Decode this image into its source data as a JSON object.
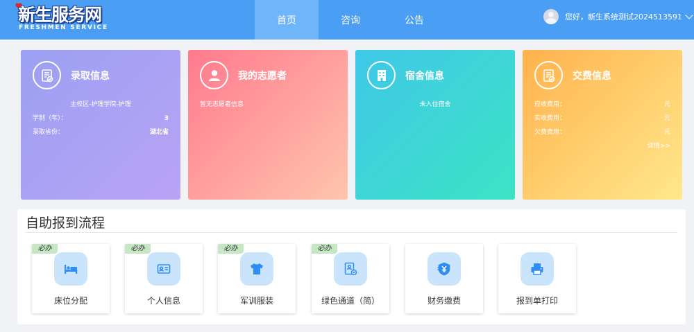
{
  "header": {
    "logo_main": "新生服务网",
    "logo_sub": "FRESHMEN SERVICE",
    "nav": [
      {
        "label": "首页",
        "active": true
      },
      {
        "label": "咨询",
        "active": false
      },
      {
        "label": "公告",
        "active": false
      }
    ],
    "user_greeting": "您好，新生系统测试2024513591"
  },
  "cards": {
    "admission": {
      "title": "录取信息",
      "icon": "document-check-icon",
      "campus_major": "主校区-护理学院-护理",
      "rows": [
        {
          "label": "学制（年）：",
          "value": "3"
        },
        {
          "label": "录取省份：",
          "value": "湖北省"
        }
      ]
    },
    "volunteer": {
      "title": "我的志愿者",
      "icon": "person-icon",
      "empty_text": "暂无志愿者信息"
    },
    "dorm": {
      "title": "宿舍信息",
      "icon": "building-icon",
      "empty_text": "未入住宿舍"
    },
    "fee": {
      "title": "交费信息",
      "icon": "document-check-icon",
      "rows": [
        {
          "label": "应收费用：",
          "value": "元"
        },
        {
          "label": "实收费用：",
          "value": "元"
        },
        {
          "label": "欠费费用：",
          "value": "元"
        }
      ],
      "detail_link": "详情>>"
    }
  },
  "process": {
    "title": "自助报到流程",
    "steps": [
      {
        "label": "床位分配",
        "required": "必办",
        "icon": "bed-icon"
      },
      {
        "label": "个人信息",
        "required": "必办",
        "icon": "id-card-icon"
      },
      {
        "label": "军训服装",
        "required": "必办",
        "icon": "tshirt-icon"
      },
      {
        "label": "绿色通道（简）",
        "required": "必办",
        "icon": "document-settings-icon"
      },
      {
        "label": "财务缴费",
        "required": "",
        "icon": "yuan-shield-icon"
      },
      {
        "label": "报到单打印",
        "required": "",
        "icon": "printer-icon"
      }
    ]
  },
  "colors": {
    "header": "#4a9ff5",
    "nav_active": "#6fb5fa",
    "icon_blue": "#2e8ef2",
    "badge_green": "#c6e6c4"
  }
}
